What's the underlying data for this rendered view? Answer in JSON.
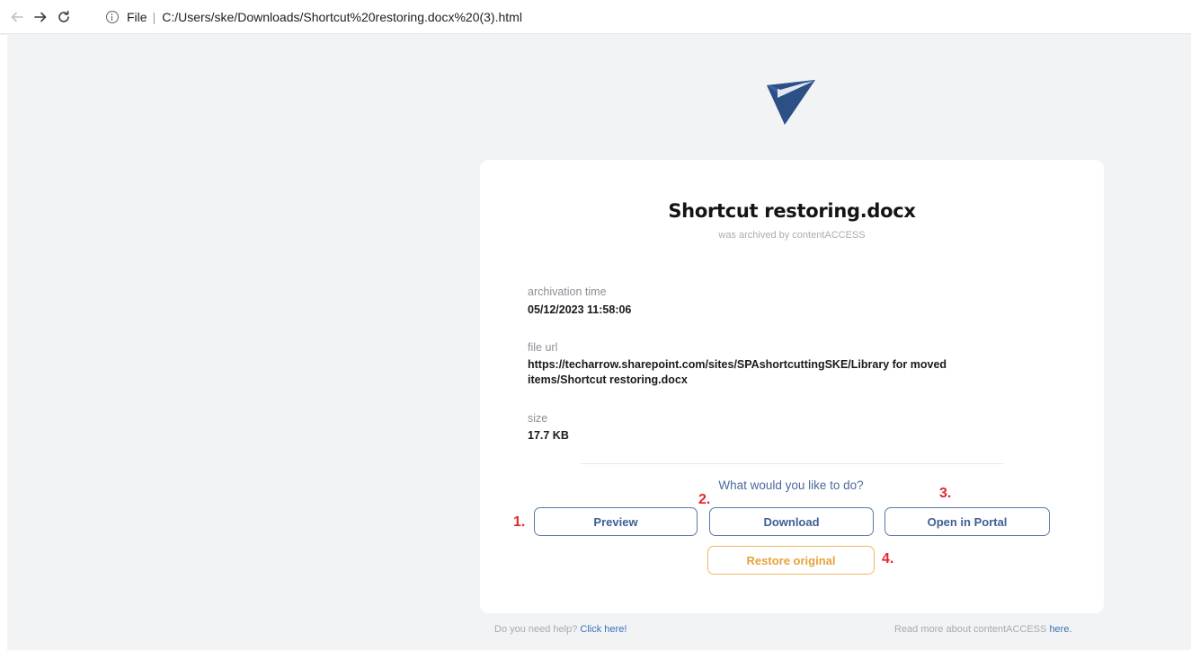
{
  "browser": {
    "scheme": "File",
    "url": "C:/Users/ske/Downloads/Shortcut%20restoring.docx%20(3).html",
    "icons": [
      "arrow-left-icon",
      "arrow-right-icon",
      "reload-icon",
      "info-icon"
    ]
  },
  "logo": {
    "icon": "paper-plane-logo",
    "color": "#2c4f86"
  },
  "card": {
    "title": "Shortcut restoring.docx",
    "subtitle": "was archived by contentACCESS",
    "fields": [
      {
        "label": "archivation time",
        "value": "05/12/2023 11:58:06"
      },
      {
        "label": "file url",
        "value_line1": "https://techarrow.sharepoint.com/sites/SPAshortcuttingSKE/Library for moved",
        "value_line2": "items/Shortcut restoring.docx"
      },
      {
        "label": "size",
        "value": "17.7 KB"
      }
    ],
    "question": "What would you like to do?",
    "buttons": {
      "preview": "Preview",
      "download": "Download",
      "portal": "Open in Portal",
      "restore": "Restore original"
    },
    "markers": [
      "1.",
      "2.",
      "3.",
      "4."
    ]
  },
  "footer": {
    "help_text": "Do you need help? ",
    "help_link": "Click here!",
    "read_text": "Read more about contentACCESS ",
    "read_link": "here."
  },
  "colors": {
    "accent": "#3e5f95",
    "restore": "#e8a23c",
    "marker": "#e3262f",
    "background": "#f1f3f4"
  }
}
